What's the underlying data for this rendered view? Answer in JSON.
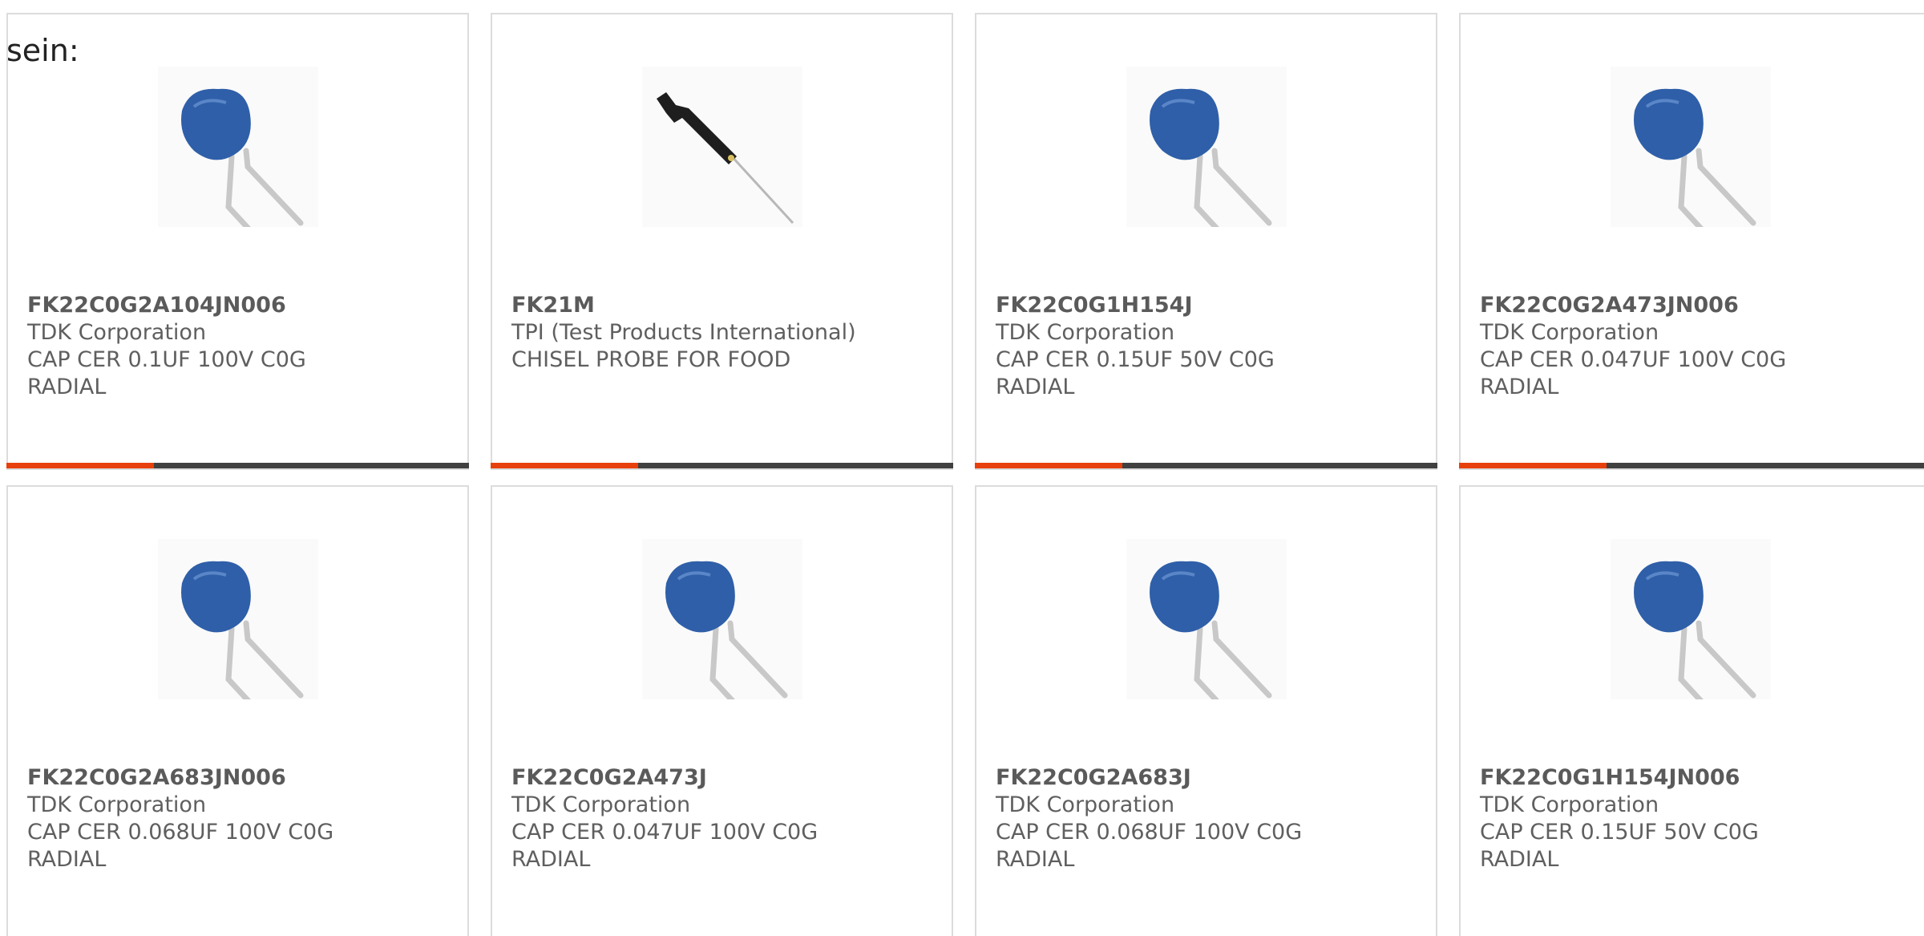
{
  "intro_text": "sein:",
  "colors": {
    "accent": "#e8400c",
    "bar": "#404040",
    "capacitor_body": "#2f5fa8"
  },
  "products": [
    {
      "part": "FK22C0G2A104JN006",
      "maker": "TDK Corporation",
      "desc": "CAP CER 0.1UF 100V C0G",
      "desc2": "RADIAL",
      "icon": "capacitor-icon"
    },
    {
      "part": "FK21M",
      "maker": "TPI (Test Products International)",
      "desc": "CHISEL PROBE FOR FOOD",
      "desc2": "",
      "icon": "probe-icon"
    },
    {
      "part": "FK22C0G1H154J",
      "maker": "TDK Corporation",
      "desc": "CAP CER 0.15UF 50V C0G",
      "desc2": "RADIAL",
      "icon": "capacitor-icon"
    },
    {
      "part": "FK22C0G2A473JN006",
      "maker": "TDK Corporation",
      "desc": "CAP CER 0.047UF 100V C0G",
      "desc2": "RADIAL",
      "icon": "capacitor-icon"
    },
    {
      "part": "FK22C0G2A683JN006",
      "maker": "TDK Corporation",
      "desc": "CAP CER 0.068UF 100V C0G",
      "desc2": "RADIAL",
      "icon": "capacitor-icon"
    },
    {
      "part": "FK22C0G2A473J",
      "maker": "TDK Corporation",
      "desc": "CAP CER 0.047UF 100V C0G",
      "desc2": "RADIAL",
      "icon": "capacitor-icon"
    },
    {
      "part": "FK22C0G2A683J",
      "maker": "TDK Corporation",
      "desc": "CAP CER 0.068UF 100V C0G",
      "desc2": "RADIAL",
      "icon": "capacitor-icon"
    },
    {
      "part": "FK22C0G1H154JN006",
      "maker": "TDK Corporation",
      "desc": "CAP CER 0.15UF 50V C0G",
      "desc2": "RADIAL",
      "icon": "capacitor-icon"
    }
  ]
}
